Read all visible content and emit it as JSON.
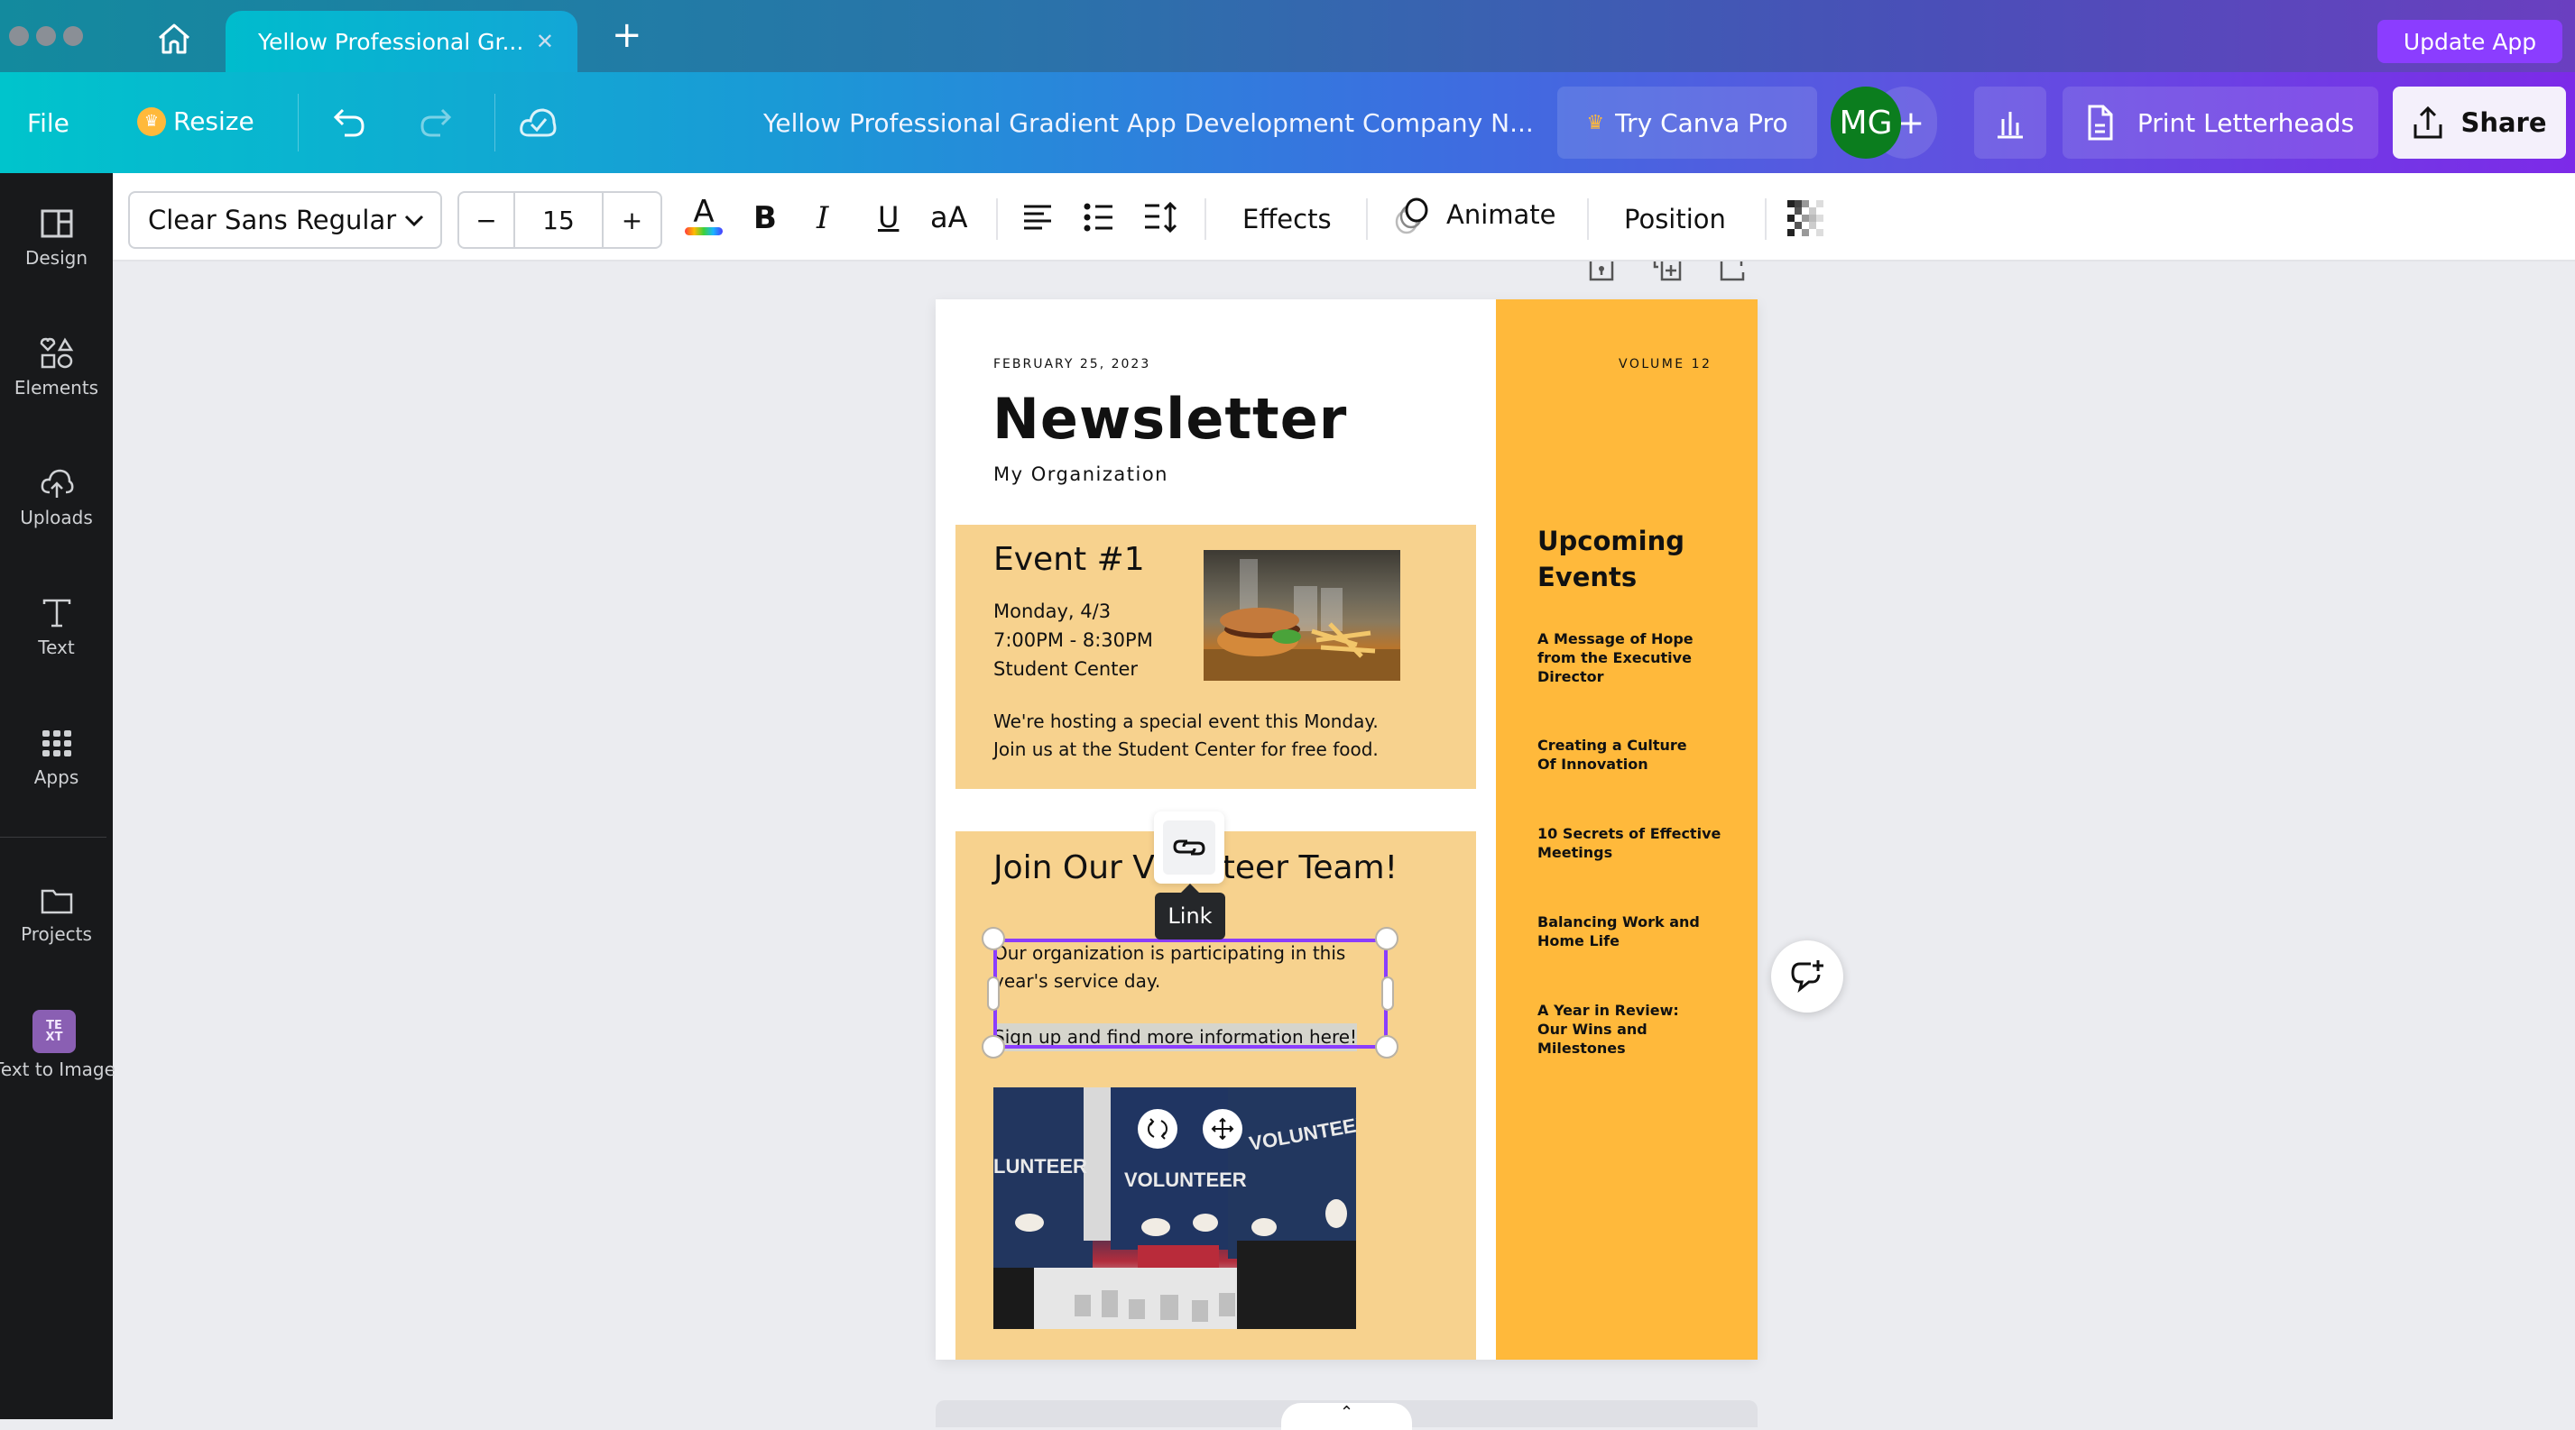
{
  "window": {
    "tab_title": "Yellow Professional Gr...",
    "update_label": "Update App"
  },
  "toolbar": {
    "file_label": "File",
    "resize_label": "Resize",
    "doc_title": "Yellow Professional Gradient App Development Company N...",
    "try_pro_label": "Try Canva Pro",
    "avatar_initials": "MG",
    "print_label": "Print Letterheads",
    "share_label": "Share"
  },
  "sidebar": {
    "items": [
      {
        "label": "Design",
        "icon": "layout-icon"
      },
      {
        "label": "Elements",
        "icon": "shapes-icon"
      },
      {
        "label": "Uploads",
        "icon": "cloud-upload-icon"
      },
      {
        "label": "Text",
        "icon": "text-icon"
      },
      {
        "label": "Apps",
        "icon": "grid-icon"
      },
      {
        "label": "Projects",
        "icon": "folder-icon"
      },
      {
        "label": "Text to Image",
        "icon": "text-to-image-icon"
      }
    ]
  },
  "format_bar": {
    "font_name": "Clear Sans Regular",
    "font_size": "15",
    "minus": "−",
    "plus": "+",
    "case_label": "aA",
    "effects_label": "Effects",
    "animate_label": "Animate",
    "position_label": "Position"
  },
  "document": {
    "date": "FEBRUARY 25, 2023",
    "title": "Newsletter",
    "organization": "My Organization",
    "volume": "VOLUME 12",
    "event": {
      "heading": "Event #1",
      "day": "Monday, 4/3",
      "time": "7:00PM - 8:30PM",
      "place": "Student Center",
      "body_line1": "We're hosting a special event this Monday.",
      "body_line2": "Join us at the Student Center for free food."
    },
    "volunteer": {
      "heading": "Join Our Volunteer Team!",
      "body_line1": "Our organization is participating in this",
      "body_line2": "year's service day.",
      "link_text": "Sign up and find more information here!"
    },
    "upcoming": {
      "heading_line1": "Upcoming",
      "heading_line2": "Events",
      "items": [
        [
          "A Message of Hope",
          "from the Executive",
          "Director"
        ],
        [
          "Creating a Culture",
          "Of Innovation"
        ],
        [
          "10 Secrets of Effective",
          "Meetings"
        ],
        [
          "Balancing Work and",
          "Home Life"
        ],
        [
          "A Year in Review:",
          "Our Wins and",
          "Milestones"
        ]
      ]
    }
  },
  "popup": {
    "link_tooltip": "Link"
  },
  "colors": {
    "accent_purple": "#8b3dff",
    "doc_yellow": "#ffb93b",
    "doc_light_yellow": "#f7d28e",
    "avatar_green": "#0b7d1e"
  }
}
